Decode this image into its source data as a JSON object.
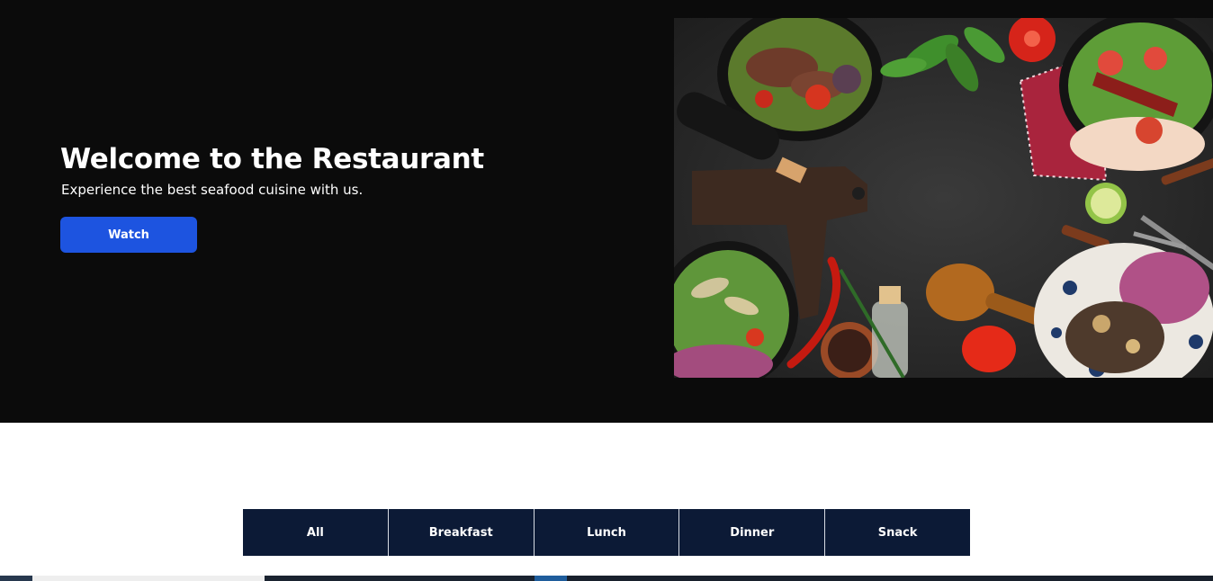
{
  "hero": {
    "title": "Welcome to the Restaurant",
    "subtitle": "Experience the best seafood cuisine with us.",
    "watch_label": "Watch",
    "accent_color": "#1d54e0",
    "background_color": "#0b0b0b"
  },
  "menu_tabs": [
    {
      "label": "All"
    },
    {
      "label": "Breakfast"
    },
    {
      "label": "Lunch"
    },
    {
      "label": "Dinner"
    },
    {
      "label": "Snack"
    }
  ],
  "tab_color": "#0c1a36"
}
